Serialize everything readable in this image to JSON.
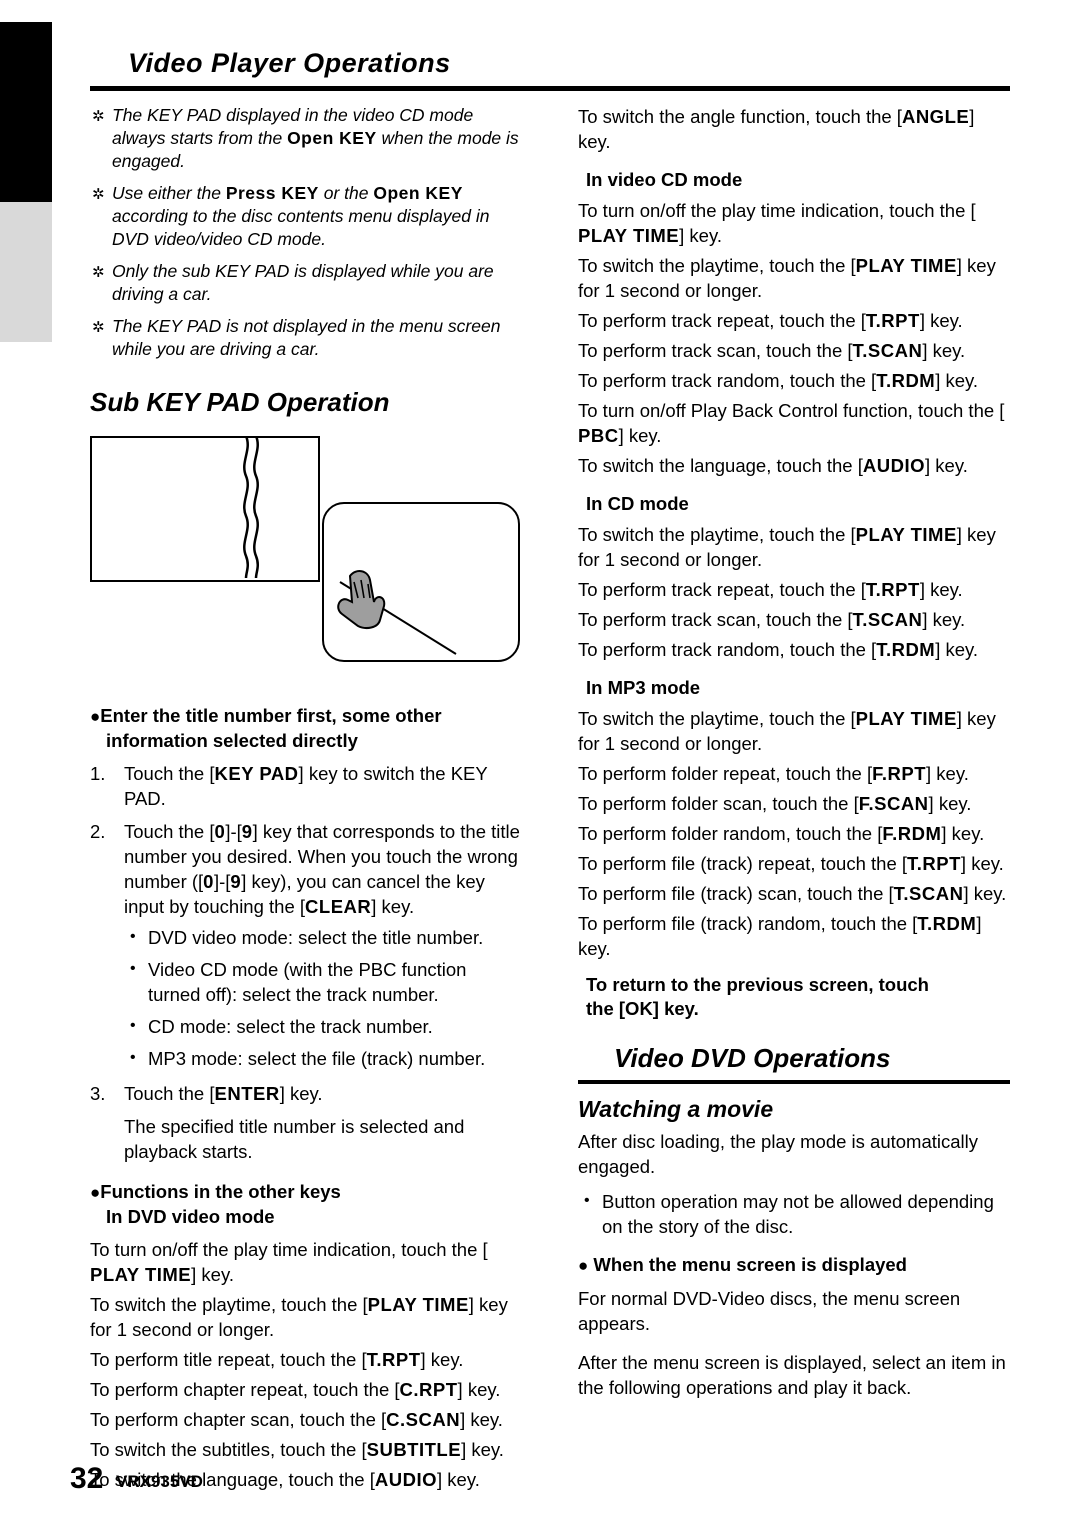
{
  "page": {
    "title": "Video Player Operations",
    "footer_number": "32",
    "footer_model": "VRX935VD"
  },
  "left_column": {
    "notes": [
      {
        "parts": [
          "The KEY PAD displayed in the video CD mode always starts from the ",
          "Open KEY",
          " when the mode is engaged."
        ]
      },
      {
        "parts": [
          "Use either the ",
          "Press KEY",
          " or the ",
          "Open KEY",
          " according to the disc contents menu displayed in DVD video/video CD mode."
        ]
      },
      {
        "parts": [
          "Only the sub KEY PAD is displayed while you are driving a car."
        ]
      },
      {
        "parts": [
          "The KEY PAD is not displayed in the menu screen while you are driving a car."
        ]
      }
    ],
    "section_heading": "Sub KEY PAD Operation",
    "procedure_heading_line1": "Enter the title number first, some other",
    "procedure_heading_line2": "information selected directly",
    "steps": [
      {
        "num": "1.",
        "text_parts": [
          "Touch the [",
          "KEY PAD",
          "] key to switch the KEY PAD."
        ]
      },
      {
        "num": "2.",
        "text_parts": [
          "Touch the [",
          "0",
          "]-[",
          "9",
          "] key that corresponds to the title number you desired. When you touch the wrong number ([",
          "0",
          "]-[",
          "9",
          "] key), you can cancel the key input by touching the [",
          "CLEAR",
          "] key."
        ]
      },
      {
        "num": "3.",
        "text_parts": [
          "Touch the [",
          "ENTER",
          "] key."
        ]
      }
    ],
    "step2_bullets": [
      "DVD video mode: select the title number.",
      "Video CD mode (with the PBC function turned off): select the track number.",
      "CD mode: select the track number.",
      "MP3 mode: select the file (track) number."
    ],
    "step3_note_line1": "The specified title number is selected and",
    "step3_note_line2": "playback starts.",
    "functions_heading_line1": "Functions in the other keys",
    "functions_heading_line2": "In DVD video mode",
    "function_lines": [
      {
        "parts": [
          "To turn on/off the play time indication, touch the [",
          "PLAY TIME",
          "] key."
        ]
      },
      {
        "parts": [
          "To switch the playtime, touch the [",
          "PLAY TIME",
          "] key for 1 second or longer."
        ]
      },
      {
        "parts": [
          "To perform title repeat, touch the [",
          "T.RPT",
          "] key."
        ]
      },
      {
        "parts": [
          "To perform chapter repeat, touch the [",
          "C.RPT",
          "] key."
        ]
      },
      {
        "parts": [
          "To perform chapter scan, touch the [",
          "C.SCAN",
          "] key."
        ]
      },
      {
        "parts": [
          "To switch the subtitles, touch the [",
          "SUBTITLE",
          "] key."
        ]
      },
      {
        "parts": [
          "To switch the language, touch the [",
          "AUDIO",
          "] key."
        ]
      }
    ]
  },
  "right_column": {
    "top_lines": [
      {
        "parts": [
          "To switch the angle function, touch the [",
          "ANGLE",
          "] key."
        ]
      }
    ],
    "heading_videocd": "In video CD mode",
    "videocd_lines": [
      {
        "parts": [
          "To turn on/off the play time indication, touch the [",
          "PLAY TIME",
          "] key."
        ]
      },
      {
        "parts": [
          "To switch the playtime, touch the [",
          "PLAY TIME",
          "] key for 1 second or longer."
        ]
      },
      {
        "parts": [
          "To perform track repeat, touch the [",
          "T.RPT",
          "] key."
        ]
      },
      {
        "parts": [
          "To perform track scan, touch the [",
          "T.SCAN",
          "] key."
        ]
      },
      {
        "parts": [
          "To perform track random, touch the [",
          "T.RDM",
          "] key."
        ]
      },
      {
        "parts": [
          "To turn on/off Play Back Control function, touch the [",
          "PBC",
          "] key."
        ]
      },
      {
        "parts": [
          "To switch the language, touch the [",
          "AUDIO",
          "] key."
        ]
      }
    ],
    "heading_cd": "In CD mode",
    "cd_lines": [
      {
        "parts": [
          "To switch the playtime, touch the [",
          "PLAY TIME",
          "] key for 1 second or longer."
        ]
      },
      {
        "parts": [
          "To perform track repeat, touch the [",
          "T.RPT",
          "] key."
        ]
      },
      {
        "parts": [
          "To perform track scan, touch the [",
          "T.SCAN",
          "] key."
        ]
      },
      {
        "parts": [
          "To perform track random, touch the [",
          "T.RDM",
          "] key."
        ]
      }
    ],
    "heading_mp3": "In MP3 mode",
    "mp3_lines": [
      {
        "parts": [
          "To switch the playtime, touch the [",
          "PLAY TIME",
          "] key for 1 second or longer."
        ]
      },
      {
        "parts": [
          "To perform folder repeat, touch the [",
          "F.RPT",
          "] key."
        ]
      },
      {
        "parts": [
          "To perform folder scan, touch the [",
          "F.SCAN",
          "] key."
        ]
      },
      {
        "parts": [
          "To perform folder random, touch the [",
          "F.RDM",
          "] key."
        ]
      },
      {
        "parts": [
          "To perform file (track) repeat, touch the [",
          "T.RPT",
          "] key."
        ]
      },
      {
        "parts": [
          "To perform file (track) scan, touch the [",
          "T.SCAN",
          "] key."
        ]
      },
      {
        "parts": [
          "To perform file (track) random, touch the [",
          "T.RDM",
          "] key."
        ]
      }
    ],
    "return_note_line1": "To return to the previous screen, touch",
    "return_note_line2": "the [OK] key.",
    "section_heading": "Video DVD Operations",
    "watching_heading": "Watching a movie",
    "watching_lines": [
      "After disc loading, the play mode is automatically engaged."
    ],
    "watching_bullets": [
      "Button operation may not be allowed depending on the story of the disc."
    ],
    "menu_heading": "When the menu screen is displayed",
    "menu_lines": [
      "For normal DVD-Video discs, the menu screen appears.",
      "After the menu screen is displayed, select an item in the following operations and play it back."
    ]
  }
}
